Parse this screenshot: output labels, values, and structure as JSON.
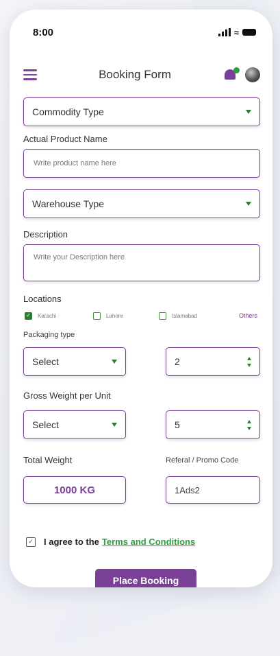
{
  "status_bar": {
    "time": "8:00"
  },
  "header": {
    "title": "Booking Form"
  },
  "form": {
    "commodity_type": {
      "value": "Commodity Type"
    },
    "product_name": {
      "label": "Actual Product Name",
      "placeholder": "Write product name here"
    },
    "warehouse_type": {
      "value": "Warehouse Type"
    },
    "description": {
      "label": "Description",
      "placeholder": "Write your Description here"
    },
    "locations": {
      "label": "Locations",
      "options": [
        {
          "label": "Karachi",
          "checked": true
        },
        {
          "label": "Lahore",
          "checked": false
        },
        {
          "label": "Islamabad",
          "checked": false
        }
      ],
      "others_label": "Others"
    },
    "packaging": {
      "label": "Packaging type",
      "select_value": "Select",
      "quantity": "2"
    },
    "gross_weight": {
      "label": "Gross Weight per Unit",
      "select_value": "Select",
      "quantity": "5"
    },
    "total_weight": {
      "label": "Total Weight",
      "value": "1000 KG"
    },
    "promo": {
      "label": "Referal / Promo Code",
      "value": "1Ads2"
    },
    "agree": {
      "prefix": "I agree to the",
      "link": "Terms and Conditions"
    },
    "submit_label": "Place Booking"
  },
  "colors": {
    "brand": "#7a3f97",
    "accent_green": "#2e9d3c"
  }
}
